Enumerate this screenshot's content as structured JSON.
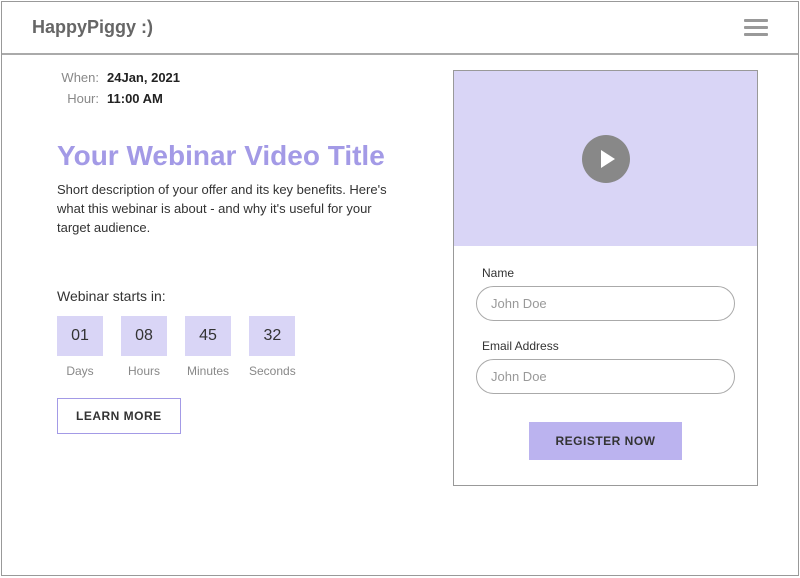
{
  "header": {
    "brand": "HappyPiggy :)"
  },
  "meta": {
    "when_label": "When:",
    "when_value": "24Jan, 2021",
    "hour_label": "Hour:",
    "hour_value": "11:00 AM"
  },
  "main": {
    "title": "Your Webinar Video Title",
    "description": "Short description of your offer and its key benefits. Here's what this webinar is about - and why it's useful for your target audience."
  },
  "countdown": {
    "label": "Webinar starts in:",
    "items": [
      {
        "value": "01",
        "unit": "Days"
      },
      {
        "value": "08",
        "unit": "Hours"
      },
      {
        "value": "45",
        "unit": "Minutes"
      },
      {
        "value": "32",
        "unit": "Seconds"
      }
    ]
  },
  "buttons": {
    "learn_more": "LEARN MORE",
    "register": "REGISTER NOW"
  },
  "form": {
    "name_label": "Name",
    "name_placeholder": "John Doe",
    "email_label": "Email Address",
    "email_placeholder": "John Doe"
  }
}
